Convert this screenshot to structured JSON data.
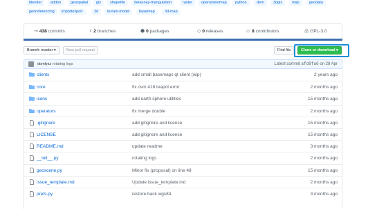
{
  "topics": [
    {
      "label": "blender"
    },
    {
      "label": "addon"
    },
    {
      "label": "geospatial"
    },
    {
      "label": "gis"
    },
    {
      "label": "shapefile"
    },
    {
      "label": "delaunay-triangulation"
    },
    {
      "label": "raster"
    },
    {
      "label": "openstreetmap"
    },
    {
      "label": "python"
    },
    {
      "label": "dem"
    },
    {
      "label": "3dgis"
    },
    {
      "label": "map"
    },
    {
      "label": "geodata"
    },
    {
      "label": "georeferencing"
    },
    {
      "label": "importexport"
    },
    {
      "label": "3d"
    },
    {
      "label": "terrain-model"
    },
    {
      "label": "basemap"
    },
    {
      "label": "3d-map"
    }
  ],
  "summary": {
    "commits_count": "438",
    "commits_label": "commits",
    "branches_count": "2",
    "branches_label": "branches",
    "packages_count": "0",
    "packages_label": "packages",
    "releases_count": "0",
    "releases_label": "releases",
    "contributors_count": "8",
    "contributors_label": "contributors",
    "license": "GPL-3.0"
  },
  "toolbar": {
    "branch_label": "Branch: master",
    "new_pr_label": "New pull request",
    "find_file_label": "Find file",
    "clone_label": "Clone or download"
  },
  "latest_commit": {
    "author": "domlysz",
    "message": "rotating logs",
    "prefix": "Latest commit",
    "sha": "afd9fa6",
    "date": "on 28 Apr"
  },
  "files": [
    {
      "type": "dir",
      "name": "clients",
      "message": "add small basemaps qt client (wip)",
      "age": "2 years ago"
    },
    {
      "type": "dir",
      "name": "core",
      "message": "fix osm 418 teapot error",
      "age": "2 months ago"
    },
    {
      "type": "dir",
      "name": "icons",
      "message": "add earth sphere utilities",
      "age": "15 months ago"
    },
    {
      "type": "dir",
      "name": "operators",
      "message": "fix merge double",
      "age": "2 months ago"
    },
    {
      "type": "file",
      "name": ".gitignore",
      "message": "add gitignore and license",
      "age": "15 months ago"
    },
    {
      "type": "file",
      "name": "LICENSE",
      "message": "add gitignore and license",
      "age": "15 months ago"
    },
    {
      "type": "file",
      "name": "README.md",
      "message": "update readme",
      "age": "3 months ago"
    },
    {
      "type": "file",
      "name": "__init__.py",
      "message": "rotating logs",
      "age": "2 months ago"
    },
    {
      "type": "file",
      "name": "geoscene.py",
      "message": "Minor fix (proposal) on line 48",
      "age": "15 months ago"
    },
    {
      "type": "file",
      "name": "issue_template.md",
      "message": "Update issue_template.md",
      "age": "2 months ago"
    },
    {
      "type": "file",
      "name": "prefs.py",
      "message": "restore back wgs84",
      "age": "3 months ago"
    }
  ],
  "colors": {
    "link": "#0366d6",
    "folder": "#79b8ff",
    "clone_button": "#2cbe4e",
    "highlight": "#1b8ed8",
    "language_bar": "#3a6fb0"
  },
  "icons": {
    "commits": "commit-icon",
    "branches": "branch-icon",
    "packages": "package-icon",
    "releases": "tag-icon",
    "contributors": "people-icon",
    "license": "law-icon",
    "dir": "folder-icon",
    "file": "file-icon"
  }
}
